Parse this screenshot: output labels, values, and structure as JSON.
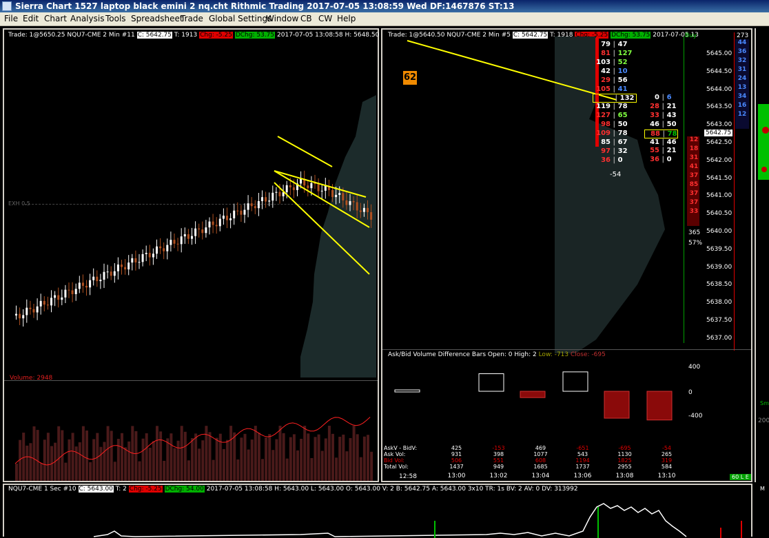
{
  "window": {
    "title": "Sierra Chart 1527 laptop black emini 2 nq.cht  Rithmic Trading 2017-07-05  13:08:59 Wed  DF:1467876  ST:13"
  },
  "menu": [
    "File",
    "Edit",
    "Chart",
    "Analysis",
    "Tools",
    "Spreadsheet",
    "Trade",
    "Global Settings",
    "Window",
    "CB",
    "CW",
    "Help"
  ],
  "chart1": {
    "header": "Trade: 1@5650.25  NQU7-CME  2 Min  #11",
    "close": "C: 5642.75",
    "trades": "T: 1913",
    "chg": "Chg: -5.25",
    "dchg": "DChg: 53.75",
    "ohlc": "2017-07-05 13:08:58 H: 5648.50 L: 5642.00 O: 5",
    "exh": "EXH 0.5",
    "volume_label": "Volume: 2948"
  },
  "chart2": {
    "header": "Trade: 1@5640.50  NQU7-CME  2 Min  #5",
    "close": "C: 5642.75",
    "trades": "T: 1918",
    "chg": "Chg: -5.25",
    "dchg": "DChg: 53.75",
    "time": "2017-07-05 13",
    "badge": "62",
    "buy_label": "Buy",
    "top_right": "273",
    "current_price": "5642.75",
    "delta": "-54",
    "stat1": "365",
    "stat2": "57%",
    "prices": [
      "5645.00",
      "5644.50",
      "5644.00",
      "5643.50",
      "5643.00",
      "5642.50",
      "5642.00",
      "5641.50",
      "5641.00",
      "5640.50",
      "5640.00",
      "5639.50",
      "5639.00",
      "5638.50",
      "5638.00",
      "5637.50",
      "5637.00"
    ],
    "ladder": [
      {
        "b": "79",
        "a": "47"
      },
      {
        "b": "81",
        "a": "127"
      },
      {
        "b": "103",
        "a": "52"
      },
      {
        "b": "42",
        "a": "10"
      },
      {
        "b": "29",
        "a": "56"
      },
      {
        "b": "105",
        "a": "41"
      },
      {
        "b": "",
        "a": "132"
      },
      {
        "b": "119",
        "a": "78"
      },
      {
        "b": "127",
        "a": "65"
      },
      {
        "b": "98",
        "a": "50"
      },
      {
        "b": "109",
        "a": "78"
      },
      {
        "b": "85",
        "a": "67"
      },
      {
        "b": "97",
        "a": "32"
      },
      {
        "b": "36",
        "a": "0"
      }
    ],
    "ladder2": [
      {
        "b": "0",
        "a": "6"
      },
      {
        "b": "28",
        "a": "21"
      },
      {
        "b": "33",
        "a": "43"
      },
      {
        "b": "46",
        "a": "50"
      },
      {
        "b": "88",
        "a": "78"
      },
      {
        "b": "41",
        "a": "46"
      },
      {
        "b": "55",
        "a": "21"
      },
      {
        "b": "36",
        "a": "0"
      }
    ],
    "ask_depth": [
      "44",
      "36",
      "32",
      "31",
      "24",
      "13",
      "34",
      "16",
      "12"
    ],
    "bid_depth": [
      "12",
      "18",
      "31",
      "41",
      "37",
      "85",
      "37",
      "37",
      "33"
    ]
  },
  "study": {
    "title": "Ask/Bid Volume Difference Bars  Open: 0  High: 2",
    "low": "Low: -713",
    "close": "Close: -695",
    "axis": [
      "400",
      "0",
      "-400"
    ],
    "footer_labels": [
      "AskV - BidV:",
      "Ask Vol:",
      "Bid Vol:",
      "Total Vol:"
    ],
    "columns": [
      {
        "diff": "425",
        "ask": "931",
        "bid": "506",
        "total": "1437",
        "time": "13:00"
      },
      {
        "diff": "-153",
        "ask": "398",
        "bid": "551",
        "total": "949",
        "time": "13:02"
      },
      {
        "diff": "469",
        "ask": "1077",
        "bid": "608",
        "total": "1685",
        "time": "13:04"
      },
      {
        "diff": "-651",
        "ask": "543",
        "bid": "1194",
        "total": "1737",
        "time": "13:06"
      },
      {
        "diff": "-695",
        "ask": "1130",
        "bid": "1825",
        "total": "2955",
        "time": "13:08"
      },
      {
        "diff": "-54",
        "ask": "265",
        "bid": "319",
        "total": "584",
        "time": "13:10"
      }
    ],
    "first_time": "12:58",
    "status": "60 L E"
  },
  "chart3": {
    "header": "NQU7-CME  1 Sec  #10",
    "close": "C: 5643.00",
    "trades": "T: 2",
    "chg": "Chg: -5.25",
    "dchg": "DChg: 54.00",
    "rest": "2017-07-05 13:08:58  H: 5643.00  L: 5643.00  O: 5643.00  V: 2  B: 5642.75  A: 5643.00  3x10  TR: 1s  BV: 2  AV: 0  DV: 313992"
  },
  "right_edge": {
    "label1": "Sm",
    "label2": "200",
    "label3": "M"
  }
}
